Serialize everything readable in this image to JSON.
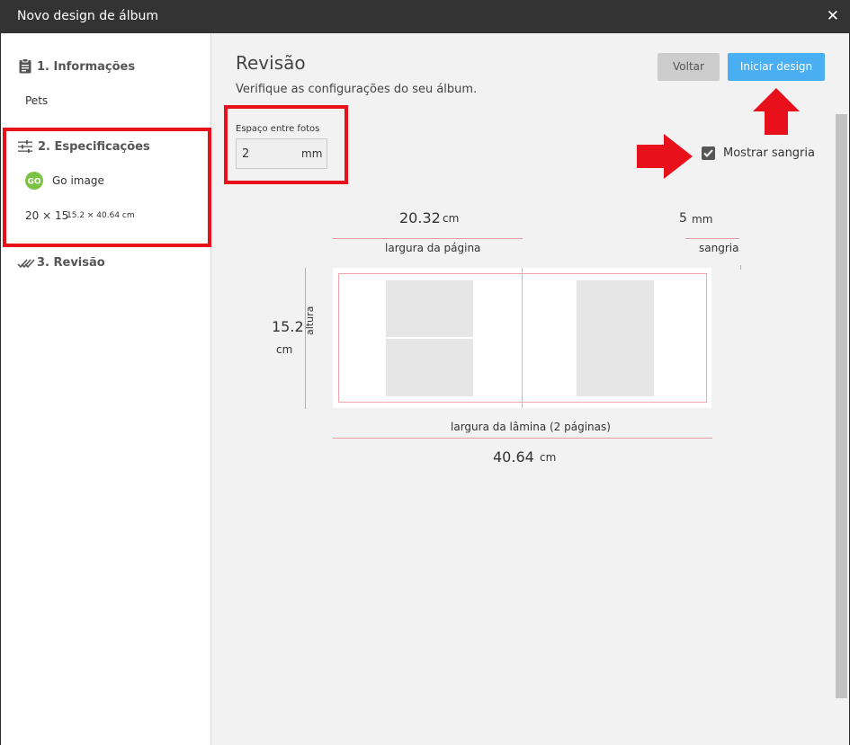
{
  "window": {
    "title": "Novo design de álbum",
    "close_icon": "close-icon"
  },
  "sidebar": {
    "step1": {
      "label": "1. Informações",
      "icon": "clipboard-icon",
      "detail": "Pets"
    },
    "step2": {
      "label": "2. Especificações",
      "icon": "sliders-icon",
      "brand": "Go image",
      "brand_icon": "go-logo-icon",
      "size": "20 × 15",
      "size_detail": "15.2 × 40.64 cm"
    },
    "step3": {
      "label": "3. Revisão",
      "icon": "double-check-icon"
    }
  },
  "main": {
    "title": "Revisão",
    "subtitle": "Verifique as configurações do seu álbum.",
    "buttons": {
      "back": "Voltar",
      "start": "Iniciar design"
    },
    "spacing": {
      "label": "Espaço entre fotos",
      "value": "2",
      "unit": "mm"
    },
    "bleed_checkbox": {
      "label": "Mostrar sangria",
      "checked": true
    },
    "diagram": {
      "page_width_value": "20.32",
      "page_width_unit": "cm",
      "page_width_label": "largura da página",
      "bleed_value": "5",
      "bleed_unit": "mm",
      "bleed_label": "sangria",
      "height_value": "15.2",
      "height_unit": "cm",
      "height_label": "altura",
      "spread_label": "largura da lâmina (2 páginas)",
      "spread_value": "40.64",
      "spread_unit": "cm"
    }
  },
  "colors": {
    "accent": "#4aaef2",
    "annotation": "#e8101a",
    "guide": "#e79aa6"
  }
}
